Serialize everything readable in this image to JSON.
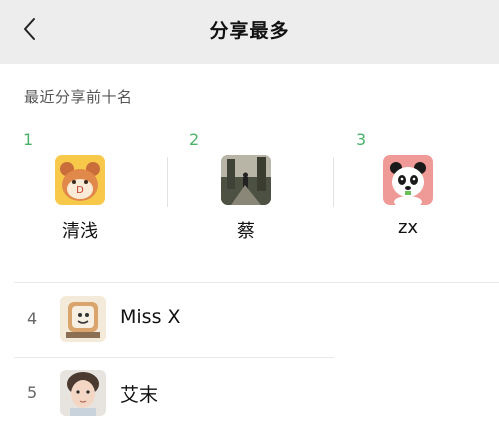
{
  "nav": {
    "title": "分享最多",
    "back_icon": "chevron-left-icon"
  },
  "section": {
    "title": "最近分享前十名"
  },
  "top_three": [
    {
      "rank": "1",
      "name": "清浅",
      "avatar": "cartoon-bear-avatar"
    },
    {
      "rank": "2",
      "name": "蔡",
      "avatar": "street-photo-avatar"
    },
    {
      "rank": "3",
      "name": "zx",
      "avatar": "panda-avatar"
    }
  ],
  "list": [
    {
      "rank": "4",
      "name": "Miss X",
      "avatar": "sketch-pet-avatar"
    },
    {
      "rank": "5",
      "name": "艾末",
      "avatar": "child-portrait-avatar"
    }
  ],
  "colors": {
    "accent": "#4cb26b",
    "nav_bg": "#ededed"
  }
}
